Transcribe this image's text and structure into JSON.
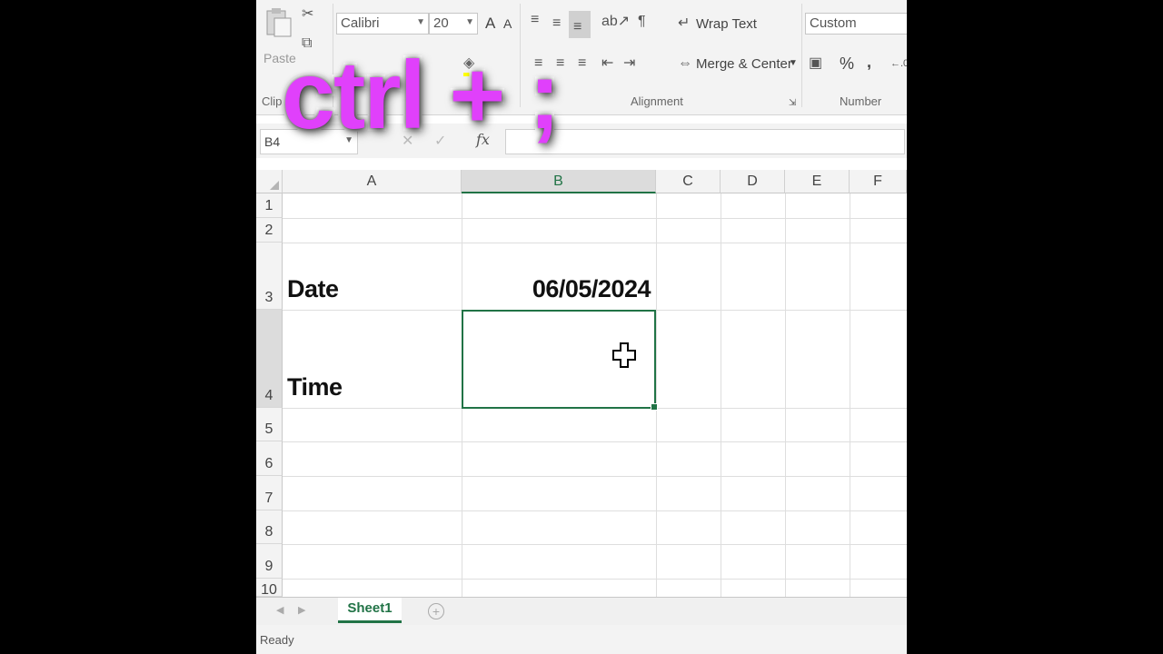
{
  "ribbon": {
    "clipboard": {
      "paste_label": "Paste",
      "group_label": "Clip"
    },
    "font": {
      "font_name": "Calibri",
      "font_size": "20",
      "grow_label": "A",
      "shrink_label": "A"
    },
    "alignment": {
      "wrap_text_label": "Wrap Text",
      "merge_center_label": "Merge & Center",
      "group_label": "Alignment"
    },
    "number": {
      "format_value": "Custom",
      "percent_label": "%",
      "comma_label": ",",
      "group_label": "Number"
    }
  },
  "formula_bar": {
    "name_box": "B4",
    "fx_label": "fx",
    "formula": ""
  },
  "grid": {
    "columns": [
      "A",
      "B",
      "C",
      "D",
      "E",
      "F"
    ],
    "selected_column": "B",
    "rows": [
      "1",
      "2",
      "3",
      "4",
      "5",
      "6",
      "7",
      "8",
      "9",
      "10"
    ],
    "cells": {
      "A3": "Date",
      "B3": "06/05/2024",
      "A4": "Time",
      "B4": ""
    },
    "active_cell": "B4"
  },
  "sheets": {
    "tabs": [
      "Sheet1"
    ],
    "active": "Sheet1"
  },
  "status_bar": {
    "text": "Ready"
  },
  "overlay": {
    "caption": "ctrl + ;"
  },
  "colors": {
    "accent": "#217346",
    "overlay_text": "#e040fb"
  }
}
